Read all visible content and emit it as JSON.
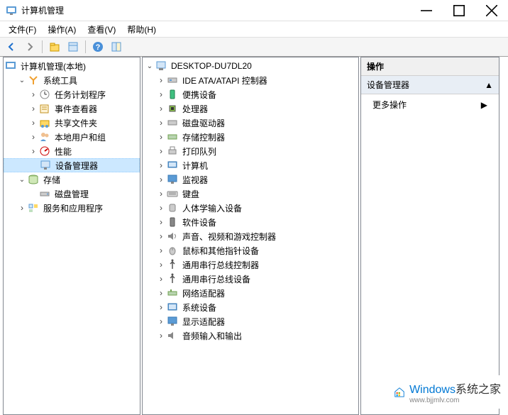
{
  "titlebar": {
    "title": "计算机管理"
  },
  "menubar": {
    "file": "文件(F)",
    "action": "操作(A)",
    "view": "查看(V)",
    "help": "帮助(H)"
  },
  "left_tree": {
    "root": "计算机管理(本地)",
    "system_tools": "系统工具",
    "task_scheduler": "任务计划程序",
    "event_viewer": "事件查看器",
    "shared_folders": "共享文件夹",
    "local_users": "本地用户和组",
    "performance": "性能",
    "device_manager": "设备管理器",
    "storage": "存储",
    "disk_management": "磁盘管理",
    "services_apps": "服务和应用程序"
  },
  "mid_tree": {
    "root": "DESKTOP-DU7DL20",
    "ide_atapi": "IDE ATA/ATAPI 控制器",
    "portable": "便携设备",
    "processors": "处理器",
    "disk_drives": "磁盘驱动器",
    "storage_ctrl": "存储控制器",
    "print_queues": "打印队列",
    "computer": "计算机",
    "monitors": "监视器",
    "keyboards": "键盘",
    "hid": "人体学输入设备",
    "software": "软件设备",
    "audio_video": "声音、视频和游戏控制器",
    "mice": "鼠标和其他指针设备",
    "usb_ctrl": "通用串行总线控制器",
    "usb_dev": "通用串行总线设备",
    "network": "网络适配器",
    "system_dev": "系统设备",
    "display": "显示适配器",
    "audio_io": "音频输入和输出"
  },
  "actions": {
    "header": "操作",
    "subheader": "设备管理器",
    "more": "更多操作"
  },
  "watermark": {
    "brand": "Windows",
    "brand_suffix": "系统之家",
    "url": "www.bjjmlv.com"
  }
}
